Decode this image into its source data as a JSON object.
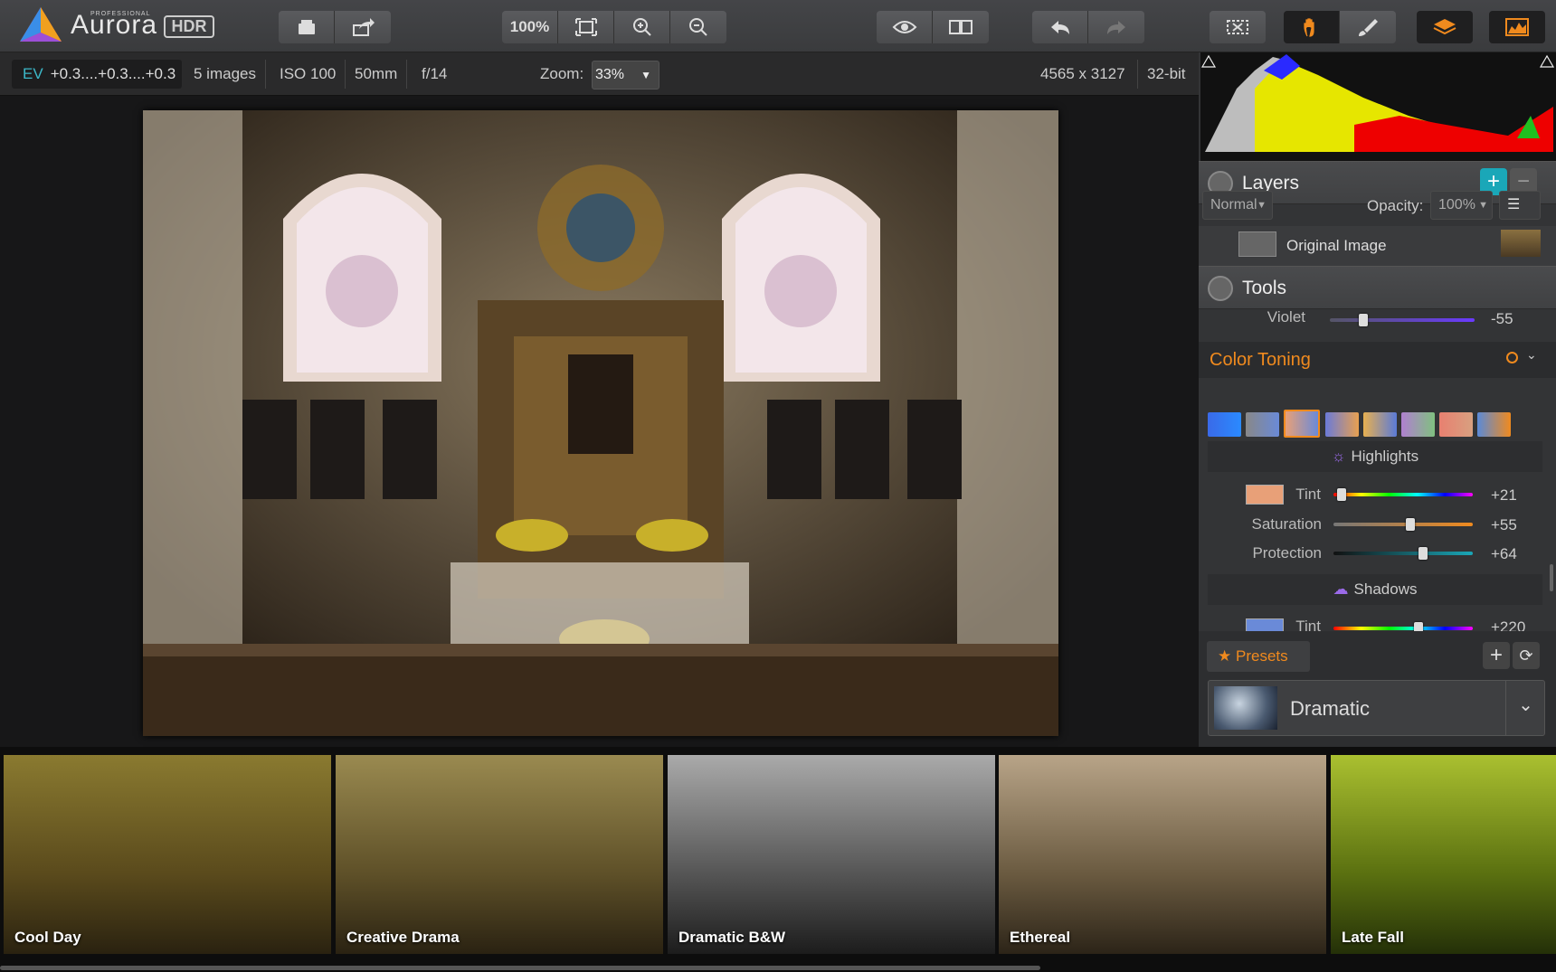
{
  "app": {
    "name": "Aurora",
    "tag": "HDR",
    "edition": "PROFESSIONAL"
  },
  "toolbar": {
    "zoom_button": "100%"
  },
  "info": {
    "ev_label": "EV",
    "ev_values": "+0.3....+0.3....+0.3",
    "images": "5 images",
    "iso": "ISO 100",
    "focal": "50mm",
    "aperture": "f/14",
    "zoom_label": "Zoom:",
    "zoom_value": "33%",
    "dimensions": "4565 x 3127",
    "bitdepth": "32-bit"
  },
  "layers": {
    "title": "Layers",
    "blend_mode": "Normal",
    "opacity_label": "Opacity:",
    "opacity_value": "100%",
    "items": [
      {
        "name": "Original Image"
      }
    ]
  },
  "tools": {
    "title": "Tools",
    "violet_label": "Violet",
    "violet_value": "-55",
    "violet_level": 0.23,
    "color_toning_title": "Color Toning",
    "highlights_title": "Highlights",
    "highlights": [
      {
        "label": "Tint",
        "value": "+21",
        "level": 0.06
      },
      {
        "label": "Saturation",
        "value": "+55",
        "level": 0.55
      },
      {
        "label": "Protection",
        "value": "+64",
        "level": 0.64
      }
    ],
    "shadows_title": "Shadows",
    "shadows": [
      {
        "label": "Tint",
        "value": "+220",
        "level": 0.61
      }
    ]
  },
  "presets": {
    "title": "Presets",
    "selected": "Dramatic"
  },
  "filmstrip": [
    {
      "label": "Cool Day"
    },
    {
      "label": "Creative Drama"
    },
    {
      "label": "Dramatic B&W"
    },
    {
      "label": "Ethereal"
    },
    {
      "label": "Late Fall"
    }
  ],
  "colors": {
    "accent": "#f08a1e",
    "teal": "#1aa7b8"
  }
}
